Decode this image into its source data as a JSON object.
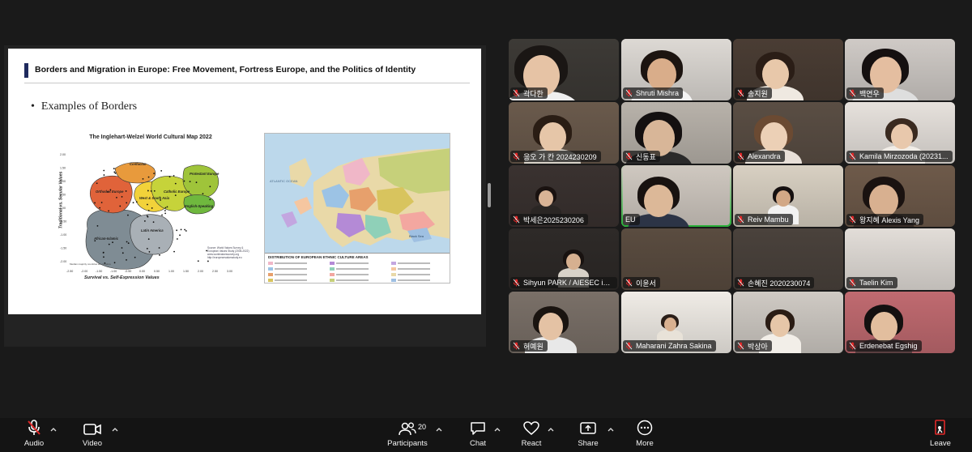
{
  "slide": {
    "title": "Borders and Migration in Europe: Free Movement, Fortress Europe, and the Politics of Identity",
    "bullet": "Examples of Borders",
    "chart_title": "The Inglehart-Welzel World Cultural Map 2022",
    "chart_xlabel": "Survival vs. Self-Expression Values",
    "chart_ylabel": "Traditional vs. Secular Values",
    "chart_source": "Source: World Values Survey & European Values Study (2005-2022) www.worldvaluessurvey.org http://europeanvaluesstudy.eu",
    "chart_note": "Median majority countries are in italics",
    "chart_regions": [
      "Confucian",
      "Protestant Europe",
      "Orthodox Europe",
      "Catholic Europe",
      "West & South Asia",
      "English-Speaking",
      "Latin America",
      "African-Islamic"
    ],
    "chart_yticks": [
      "2.00",
      "1.50",
      "1.00",
      "0.50",
      "0.00",
      "-0.50",
      "-1.00",
      "-1.50",
      "-2.00"
    ],
    "chart_xticks": [
      "-2.50",
      "-2.00",
      "-1.50",
      "-1.00",
      "-0.50",
      "0.00",
      "0.50",
      "1.00",
      "1.50",
      "2.00",
      "2.50",
      "3.00"
    ],
    "map_legend_title": "DISTRIBUTION OF EUROPEAN ETHNIC CULTURE AREAS",
    "map_ocean_label": "ATLANTIC OCEAN",
    "map_sea_label": "Black Sea"
  },
  "participants": [
    {
      "name": "곽다한",
      "muted": true
    },
    {
      "name": "Shruti Mishra",
      "muted": true
    },
    {
      "name": "송지원",
      "muted": true
    },
    {
      "name": "백연우",
      "muted": true
    },
    {
      "name": "응오 가 칸 2024230209",
      "muted": true
    },
    {
      "name": "신동표",
      "muted": true
    },
    {
      "name": "Alexandra",
      "muted": true
    },
    {
      "name": "Kamila Mirzozoda (20231...",
      "muted": true
    },
    {
      "name": "박세은2025230206",
      "muted": true
    },
    {
      "name": "EU",
      "muted": false
    },
    {
      "name": "Reiv Mambu",
      "muted": true
    },
    {
      "name": "왕지혜 Alexis Yang",
      "muted": true
    },
    {
      "name": "Sihyun PARK / AIESEC in ...",
      "muted": true
    },
    {
      "name": "이윤서",
      "muted": true
    },
    {
      "name": "손혜진 2020230074",
      "muted": true
    },
    {
      "name": "Taelin Kim",
      "muted": true
    },
    {
      "name": "허예원",
      "muted": true
    },
    {
      "name": "Maharani Zahra Sakina",
      "muted": true
    },
    {
      "name": "박상아",
      "muted": true
    },
    {
      "name": "Erdenebat Egshig",
      "muted": true
    }
  ],
  "toolbar": {
    "audio": "Audio",
    "video": "Video",
    "participants": "Participants",
    "participant_count": "20",
    "chat": "Chat",
    "react": "React",
    "share": "Share",
    "more": "More",
    "leave": "Leave"
  },
  "colors": {
    "background": "#1a1a1a",
    "toolbar": "#141414",
    "active_speaker": "#2ecc40",
    "mute_red": "#e02828",
    "leave_red": "#e02828"
  },
  "icons": [
    "mic-muted-icon",
    "camera-icon",
    "participants-icon",
    "chat-icon",
    "react-heart-icon",
    "share-screen-icon",
    "more-icon",
    "leave-icon",
    "chevron-up-icon"
  ]
}
